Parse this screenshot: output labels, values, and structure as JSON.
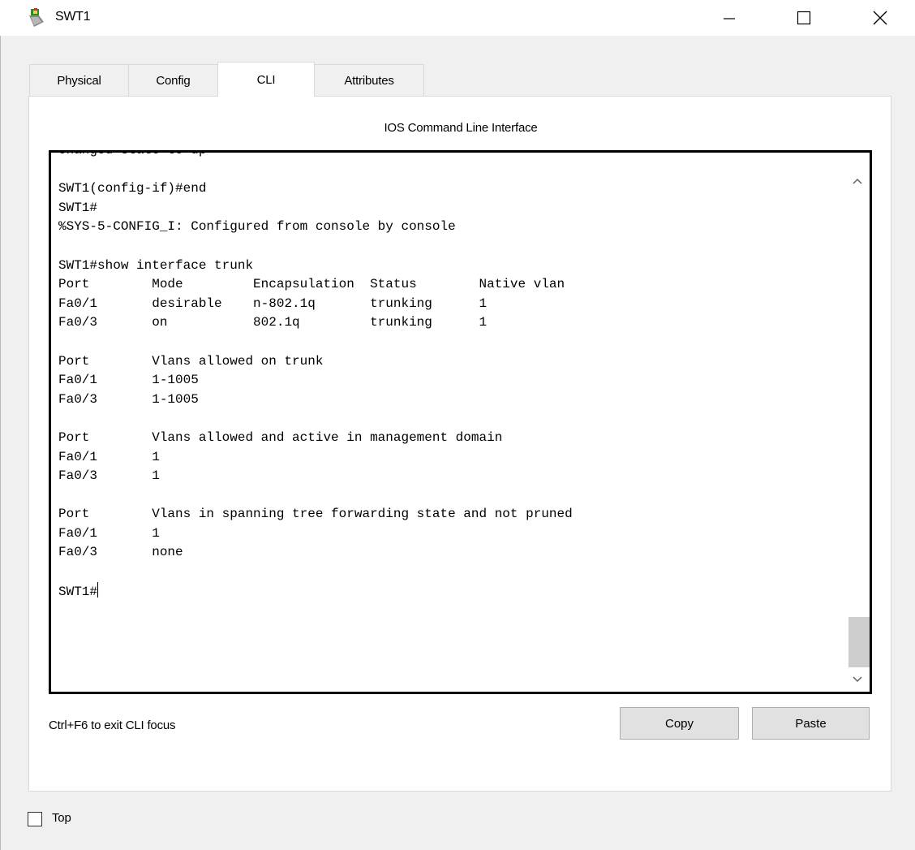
{
  "window": {
    "title": "SWT1",
    "icon": "cisco-device-icon"
  },
  "tabs": [
    {
      "label": "Physical",
      "active": false
    },
    {
      "label": "Config",
      "active": false
    },
    {
      "label": "CLI",
      "active": true
    },
    {
      "label": "Attributes",
      "active": false
    }
  ],
  "panel": {
    "title": "IOS Command Line Interface"
  },
  "console": {
    "lines": [
      "changed state to up",
      "",
      "SWT1(config-if)#end",
      "SWT1#",
      "%SYS-5-CONFIG_I: Configured from console by console",
      "",
      "SWT1#show interface trunk",
      "Port        Mode         Encapsulation  Status        Native vlan",
      "Fa0/1       desirable    n-802.1q       trunking      1",
      "Fa0/3       on           802.1q         trunking      1",
      "",
      "Port        Vlans allowed on trunk",
      "Fa0/1       1-1005",
      "Fa0/3       1-1005",
      "",
      "Port        Vlans allowed and active in management domain",
      "Fa0/1       1",
      "Fa0/3       1",
      "",
      "Port        Vlans in spanning tree forwarding state and not pruned",
      "Fa0/1       1",
      "Fa0/3       none",
      "",
      "SWT1#"
    ]
  },
  "footer": {
    "hint": "Ctrl+F6 to exit CLI focus",
    "copy_label": "Copy",
    "paste_label": "Paste"
  },
  "top_checkbox": {
    "label": "Top",
    "checked": false
  }
}
